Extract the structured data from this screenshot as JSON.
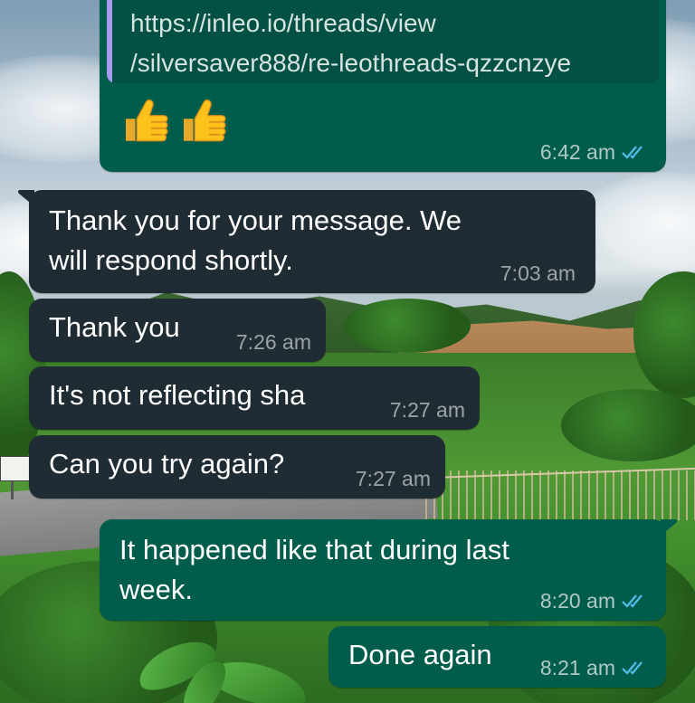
{
  "conversation": {
    "messages": [
      {
        "direction": "outgoing",
        "quote_url": "https://inleo.io/threads/view\n/silversaver888/re-leothreads-qzzcnzye",
        "emojis": [
          "thumbs-up-icon",
          "thumbs-up-icon"
        ],
        "time": "6:42 am",
        "status": "read"
      },
      {
        "direction": "incoming",
        "text": "Thank you for your message. We\nwill respond shortly.",
        "time": "7:03 am"
      },
      {
        "direction": "incoming",
        "text": "Thank you",
        "time": "7:26 am"
      },
      {
        "direction": "incoming",
        "text": "It's not reflecting sha",
        "time": "7:27 am"
      },
      {
        "direction": "incoming",
        "text": "Can you try again?",
        "time": "7:27 am"
      },
      {
        "direction": "outgoing",
        "text": "It happened like that during last\nweek.",
        "time": "8:20 am",
        "status": "read"
      },
      {
        "direction": "outgoing",
        "text": "Done again",
        "time": "8:21 am",
        "status": "read"
      }
    ]
  },
  "colors": {
    "outgoing_bubble": "#005c4b",
    "incoming_bubble": "#202c33",
    "read_ticks": "#53bdeb",
    "quote_bar": "#a79bf0"
  }
}
